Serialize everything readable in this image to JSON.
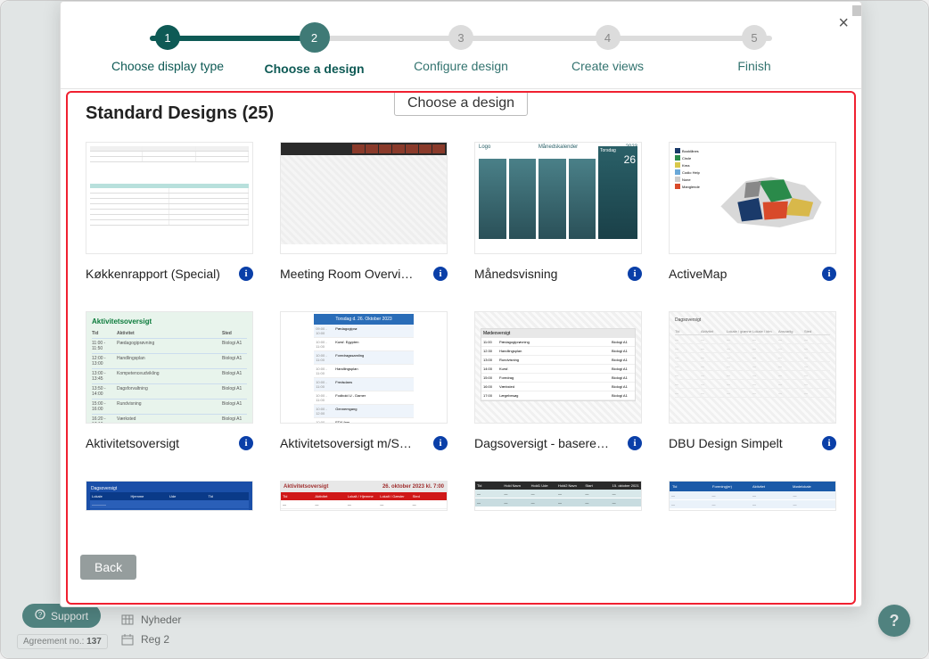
{
  "stepper": {
    "steps": [
      {
        "num": "1",
        "label": "Choose display type",
        "state": "done"
      },
      {
        "num": "2",
        "label": "Choose a design",
        "state": "current"
      },
      {
        "num": "3",
        "label": "Configure design",
        "state": "pending"
      },
      {
        "num": "4",
        "label": "Create views",
        "state": "pending"
      },
      {
        "num": "5",
        "label": "Finish",
        "state": "pending"
      }
    ],
    "tooltip": "Choose a design"
  },
  "content": {
    "heading": "Standard Designs (25)",
    "cards": [
      {
        "title": "Køkkenrapport (Special)"
      },
      {
        "title": "Meeting Room Overvi…"
      },
      {
        "title": "Månedsvisning"
      },
      {
        "title": "ActiveMap"
      },
      {
        "title": "Aktivitetsoversigt"
      },
      {
        "title": "Aktivitetsoversigt m/S…"
      },
      {
        "title": "Dagsoversigt - basere…"
      },
      {
        "title": "DBU Design Simpelt"
      }
    ],
    "thumb3": {
      "logo": "Logo",
      "title": "Månedskalender",
      "year": "2023",
      "day": "Torsdag",
      "daynum": "26"
    },
    "thumb4_legend": [
      "Booklånes",
      "Circle",
      "Krea",
      "Codio Help",
      "None",
      "Manglende"
    ],
    "thumb5_title": "Aktivitetsoversigt",
    "thumb8_title": "Dagsoversigt",
    "thumb10_title": "Aktivitetsoversigt"
  },
  "buttons": {
    "back": "Back",
    "support": "Support"
  },
  "background": {
    "items": [
      "Nyheder",
      "Reg 2"
    ],
    "agreement_label": "Agreement no.:",
    "agreement_no": "137"
  }
}
